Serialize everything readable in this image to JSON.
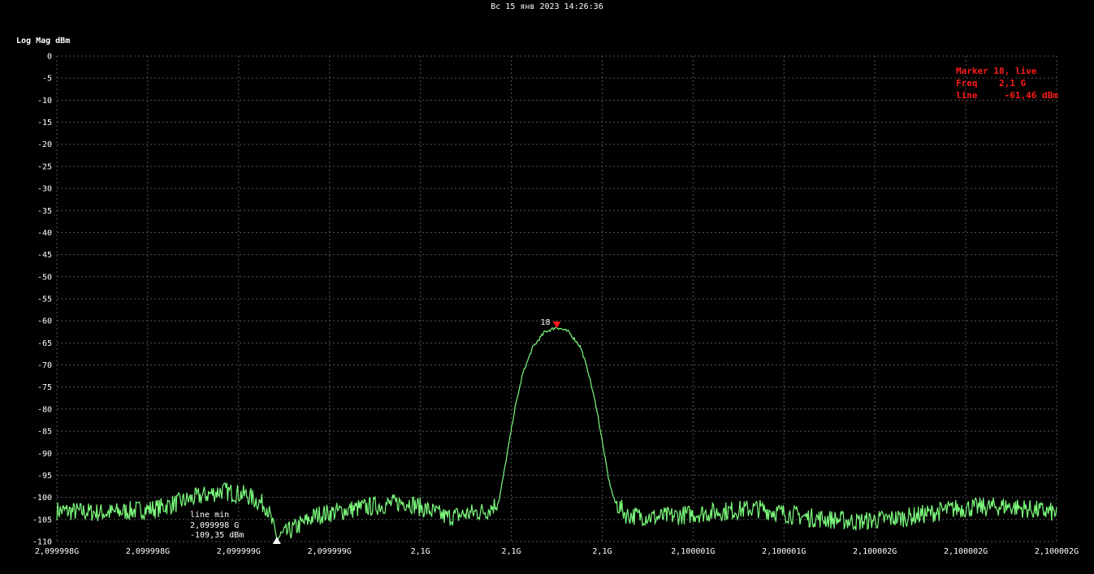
{
  "header": {
    "timestamp": "Вс 15 янв 2023 14:26:36"
  },
  "chart_data": {
    "type": "line",
    "ylabel": "Log Mag dBm",
    "ylim": [
      -110,
      0
    ],
    "y_ticks": [
      0,
      -5,
      -10,
      -15,
      -20,
      -25,
      -30,
      -35,
      -40,
      -45,
      -50,
      -55,
      -60,
      -65,
      -70,
      -75,
      -80,
      -85,
      -90,
      -95,
      -100,
      -105,
      -110
    ],
    "x_tick_labels": [
      "2,099998G",
      "2,099998G",
      "2,099999G",
      "2,099999G",
      "2,1G",
      "2,1G",
      "2,1G",
      "2,100001G",
      "2,100001G",
      "2,100002G",
      "2,100002G",
      "2,100002G"
    ],
    "grid": true,
    "series": [
      {
        "color": "#7CFC7C",
        "note_points": [
          {
            "x": 2099998.0,
            "y": -103
          },
          {
            "x": 2099998.25,
            "y": -103.5
          },
          {
            "x": 2099998.5,
            "y": -102.5
          },
          {
            "x": 2099998.7,
            "y": -100
          },
          {
            "x": 2099998.825,
            "y": -98.5
          },
          {
            "x": 2099998.95,
            "y": -99.5
          },
          {
            "x": 2099999.05,
            "y": -102
          },
          {
            "x": 2099999.1,
            "y": -109.35
          },
          {
            "x": 2099999.3,
            "y": -104
          },
          {
            "x": 2099999.5,
            "y": -102.5
          },
          {
            "x": 2099999.75,
            "y": -101
          },
          {
            "x": 2099999.95,
            "y": -104.5
          },
          {
            "x": 2100000.15,
            "y": -103
          },
          {
            "x": 2100000.21,
            "y": -101
          },
          {
            "x": 2100000.23,
            "y": -96
          },
          {
            "x": 2100000.26,
            "y": -88
          },
          {
            "x": 2100000.29,
            "y": -80
          },
          {
            "x": 2100000.33,
            "y": -72
          },
          {
            "x": 2100000.38,
            "y": -66
          },
          {
            "x": 2100000.44,
            "y": -62.5
          },
          {
            "x": 2100000.5,
            "y": -61.46
          },
          {
            "x": 2100000.56,
            "y": -62.5
          },
          {
            "x": 2100000.62,
            "y": -66
          },
          {
            "x": 2100000.66,
            "y": -72
          },
          {
            "x": 2100000.7,
            "y": -80
          },
          {
            "x": 2100000.73,
            "y": -88
          },
          {
            "x": 2100000.76,
            "y": -96
          },
          {
            "x": 2100000.79,
            "y": -101
          },
          {
            "x": 2100000.85,
            "y": -104
          },
          {
            "x": 2100001.0,
            "y": -104.5
          },
          {
            "x": 2100001.25,
            "y": -103.5
          },
          {
            "x": 2100001.5,
            "y": -102.5
          },
          {
            "x": 2100001.75,
            "y": -104.5
          },
          {
            "x": 2100002.0,
            "y": -105.5
          },
          {
            "x": 2100002.25,
            "y": -104.5
          },
          {
            "x": 2100002.5,
            "y": -102.5
          },
          {
            "x": 2100002.75,
            "y": -102
          },
          {
            "x": 2100003.0,
            "y": -103.5
          }
        ]
      }
    ],
    "xlim": [
      2099998.0,
      2100003.0
    ]
  },
  "markers": {
    "marker18": {
      "label": "18",
      "x": 2100000.5,
      "y": -61.46,
      "color": "#ff1a1a",
      "info_line1": "Marker 18, live",
      "info_line2": "Freq    2,1 G",
      "info_line3": "line     -61,46 dBm"
    },
    "min": {
      "x": 2099999.1,
      "y": -109.35,
      "line1": "line min",
      "line2": "2,099998 G",
      "line3": "-109,35 dBm"
    }
  }
}
